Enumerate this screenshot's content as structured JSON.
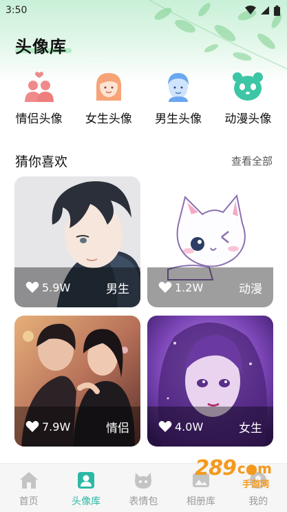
{
  "status_bar": {
    "time": "3:50"
  },
  "header": {
    "title": "头像库"
  },
  "categories": [
    {
      "label": "情侣头像",
      "icon": "couple-icon",
      "color": "#f08a8a"
    },
    {
      "label": "女生头像",
      "icon": "girl-icon",
      "color": "#f6a477"
    },
    {
      "label": "男生头像",
      "icon": "boy-icon",
      "color": "#6aa7f0"
    },
    {
      "label": "动漫头像",
      "icon": "panda-icon",
      "color": "#3cc6a6"
    }
  ],
  "section": {
    "title": "猜你喜欢",
    "see_all": "查看全部"
  },
  "cards": [
    {
      "likes": "5.9W",
      "tag": "男生"
    },
    {
      "likes": "1.2W",
      "tag": "动漫"
    },
    {
      "likes": "7.9W",
      "tag": "情侣"
    },
    {
      "likes": "4.0W",
      "tag": "女生"
    }
  ],
  "nav": [
    {
      "label": "首页",
      "icon": "home-icon",
      "active": false
    },
    {
      "label": "头像库",
      "icon": "avatar-library-icon",
      "active": true
    },
    {
      "label": "表情包",
      "icon": "emoji-icon",
      "active": false
    },
    {
      "label": "相册库",
      "icon": "album-icon",
      "active": false
    },
    {
      "label": "我的",
      "icon": "profile-icon",
      "active": false
    }
  ],
  "watermark": {
    "number": "289",
    "suffix": "c●m",
    "subtitle": "手游网"
  },
  "colors": {
    "accent": "#2bb9a5",
    "inactive": "#9a9a9a"
  }
}
